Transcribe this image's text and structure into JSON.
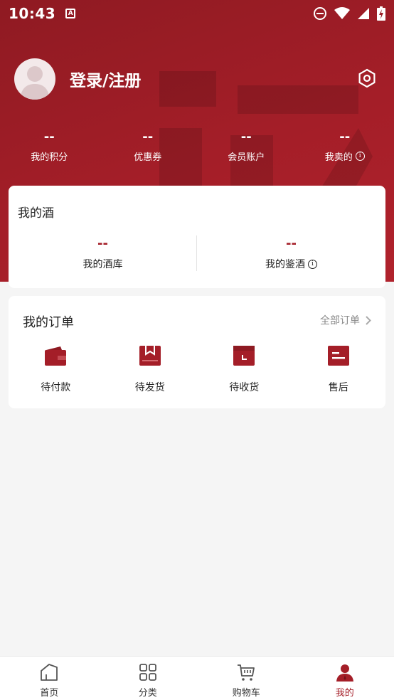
{
  "status_bar": {
    "time": "10:43",
    "notification_letter": "A"
  },
  "header": {
    "login_label": "登录/注册"
  },
  "stats": [
    {
      "value": "--",
      "label": "我的积分",
      "info": false
    },
    {
      "value": "--",
      "label": "优惠券",
      "info": false
    },
    {
      "value": "--",
      "label": "会员账户",
      "info": false
    },
    {
      "value": "--",
      "label": "我卖的",
      "info": true
    }
  ],
  "wine": {
    "title": "我的酒",
    "items": [
      {
        "value": "--",
        "label": "我的酒库",
        "info": false
      },
      {
        "value": "--",
        "label": "我的鉴酒",
        "info": true
      }
    ]
  },
  "orders": {
    "title": "我的订单",
    "all_label": "全部订单",
    "items": [
      {
        "label": "待付款",
        "icon": "wallet-icon"
      },
      {
        "label": "待发货",
        "icon": "package-icon"
      },
      {
        "label": "待收货",
        "icon": "receive-box-icon"
      },
      {
        "label": "售后",
        "icon": "after-sales-icon"
      }
    ]
  },
  "tabbar": {
    "items": [
      {
        "label": "首页",
        "icon": "home-icon",
        "active": false
      },
      {
        "label": "分类",
        "icon": "category-grid-icon",
        "active": false
      },
      {
        "label": "购物车",
        "icon": "cart-icon",
        "active": false
      },
      {
        "label": "我的",
        "icon": "profile-icon",
        "active": true
      }
    ]
  },
  "colors": {
    "brand_red": "#a41e28",
    "header_gradient_start": "#8f1a22",
    "background": "#f5f5f5"
  }
}
